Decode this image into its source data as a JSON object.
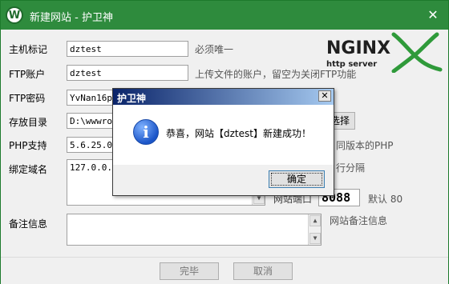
{
  "window": {
    "title": "新建网站 - 护卫神",
    "icon": "W",
    "close_glyph": "✕"
  },
  "form": {
    "host_label": "主机标记",
    "host_value": "dztest",
    "host_hint": "必须唯一",
    "ftp_user_label": "FTP账户",
    "ftp_user_value": "dztest",
    "ftp_user_hint": "上传文件的账户，留空为关闭FTP功能",
    "ftp_pass_label": "FTP密码",
    "ftp_pass_value": "YvNan16pUP",
    "dir_label": "存放目录",
    "dir_value": "D:\\wwwroot",
    "dir_button": "选择",
    "php_label": "PHP支持",
    "php_value": "5.6.25.0",
    "php_hint": "同版本的PHP",
    "domain_label": "绑定域名",
    "domain_value": "127.0.0.1",
    "domain_hint": "行分隔",
    "port_label": "网站端口",
    "port_value": "8088",
    "port_default": "默认 80",
    "note_label": "备注信息",
    "note_value": "",
    "note_hint": "网站备注信息"
  },
  "logo": {
    "brand": "NGINX",
    "tagline": "http server",
    "colors": {
      "text": "#1f1f1f",
      "x": "#2f9a3a"
    }
  },
  "footer": {
    "finish_label": "完毕",
    "cancel_label": "取消"
  },
  "dialog": {
    "title": "护卫神",
    "close_glyph": "✕",
    "icon_glyph": "i",
    "message": "恭喜，网站【dztest】新建成功！",
    "ok_label": "确定"
  },
  "colors": {
    "titlebar": "#2e8b3d",
    "dialog_title_start": "#0a246a",
    "dialog_title_end": "#a6caf0"
  }
}
